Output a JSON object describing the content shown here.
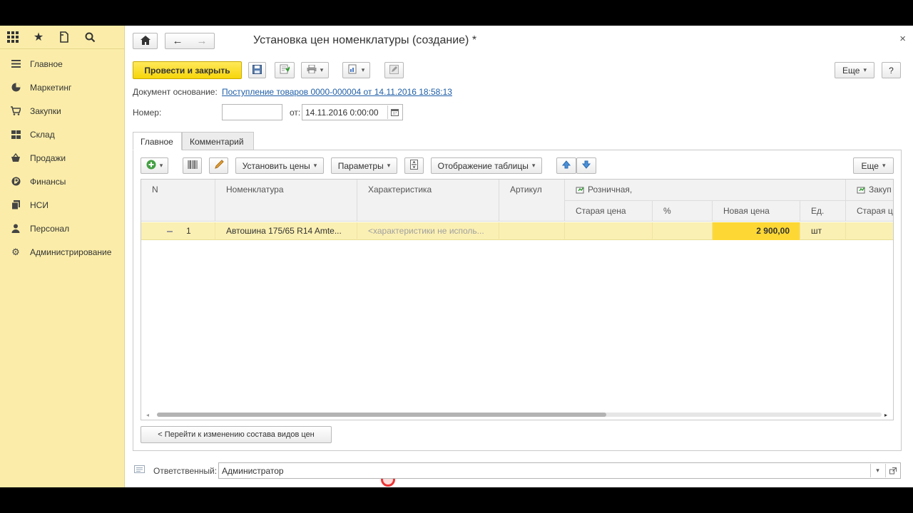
{
  "sidebar": {
    "items": [
      {
        "label": "Главное",
        "icon": "menu-icon"
      },
      {
        "label": "Маркетинг",
        "icon": "pie-chart-icon"
      },
      {
        "label": "Закупки",
        "icon": "cart-icon"
      },
      {
        "label": "Склад",
        "icon": "warehouse-icon"
      },
      {
        "label": "Продажи",
        "icon": "basket-icon"
      },
      {
        "label": "Финансы",
        "icon": "ruble-icon"
      },
      {
        "label": "НСИ",
        "icon": "files-icon"
      },
      {
        "label": "Персонал",
        "icon": "person-icon"
      },
      {
        "label": "Администрирование",
        "icon": "gear-icon"
      }
    ]
  },
  "window": {
    "title": "Установка цен номенклатуры (создание) *",
    "close": "×"
  },
  "toolbar": {
    "post_close": "Провести и закрыть",
    "more": "Еще",
    "help": "?"
  },
  "form": {
    "basis_label": "Документ основание:",
    "basis_link": "Поступление товаров 0000-000004 от 14.11.2016 18:58:13",
    "number_label": "Номер:",
    "number_value": "",
    "from_label": "от:",
    "date_value": "14.11.2016  0:00:00"
  },
  "tabs": [
    {
      "label": "Главное"
    },
    {
      "label": "Комментарий"
    }
  ],
  "table_toolbar": {
    "set_prices": "Установить цены",
    "parameters": "Параметры",
    "table_display": "Отображение таблицы",
    "more": "Еще"
  },
  "table": {
    "headers": {
      "n": "N",
      "nomenclature": "Номенклатура",
      "characteristic": "Характеристика",
      "article": "Артикул",
      "retail_group": "Розничная,",
      "old_price": "Старая цена",
      "percent": "%",
      "new_price": "Новая цена",
      "unit": "Ед.",
      "purchase_group": "Закуп",
      "purchase_old": "Старая ц"
    },
    "rows": [
      {
        "n": "1",
        "nomenclature": "Автошина 175/65 R14 Amte...",
        "characteristic": "<характеристики не исполь...",
        "article": "",
        "old_price": "",
        "percent": "",
        "new_price": "2 900,00",
        "unit": "шт"
      }
    ],
    "scroll_fraction": 0.62
  },
  "footer": {
    "goto_button": "< Перейти к изменению состава видов цен",
    "responsible_label": "Ответственный:",
    "responsible_value": "Администратор"
  },
  "colors": {
    "sidebar_bg": "#fbeda9",
    "primary_button": "#f7d50a",
    "selected_row": "#fbf0b3",
    "highlight_cell": "#fdd835",
    "link": "#1f5fa8"
  }
}
